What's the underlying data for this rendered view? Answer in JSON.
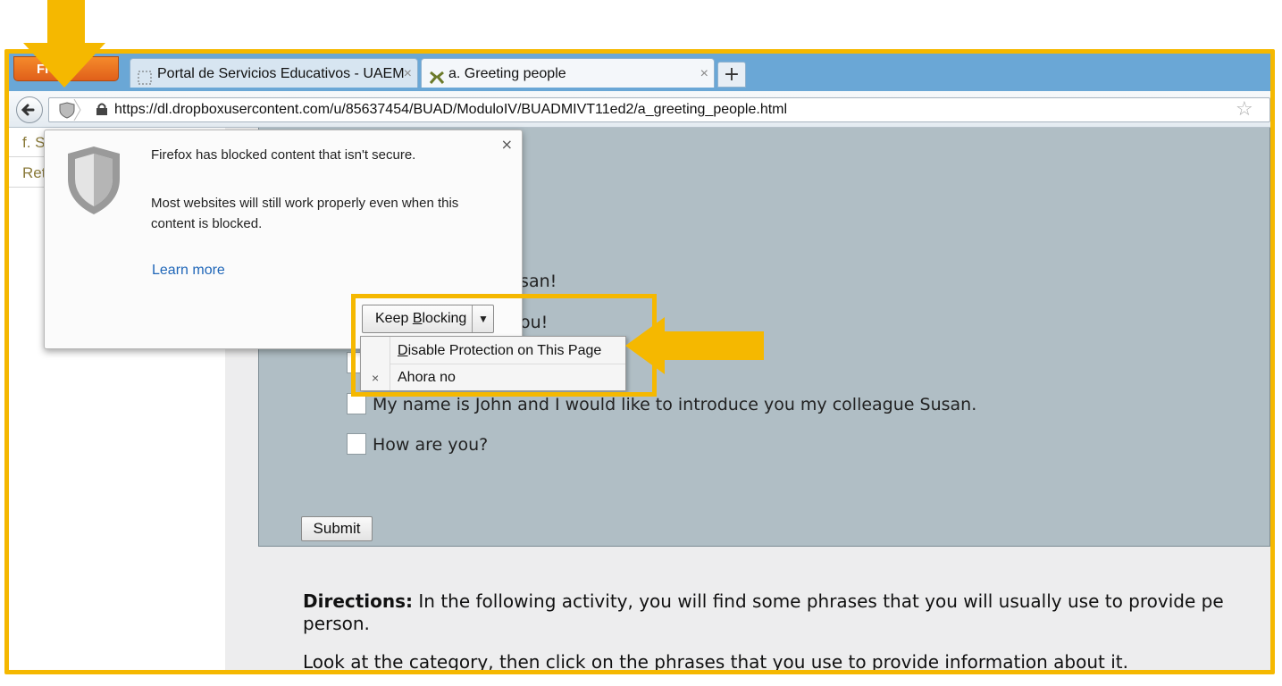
{
  "browser": {
    "menu_button": "Fi",
    "tabs": [
      {
        "title": "Portal de Servicios Educativos - UAEM",
        "close": "×"
      },
      {
        "title": "a. Greeting people",
        "close": "×"
      }
    ],
    "new_tab": "+",
    "url": "https://dl.dropboxusercontent.com/u/85637454/BUAD/ModuloIV/BUADMIVT11ed2/a_greeting_people.html"
  },
  "sidebar": {
    "items": [
      {
        "label": "f. S"
      },
      {
        "label": "Ret"
      }
    ]
  },
  "popup": {
    "close": "×",
    "line1": "Firefox has blocked content that isn't secure.",
    "line2a": "Most websites will still work properly even when this",
    "line2b": "content is blocked.",
    "learn_more": "Learn more",
    "keep_blocking_pre": "Keep ",
    "keep_blocking_acc": "B",
    "keep_blocking_post": "locking",
    "dropdown_arrow": "▼"
  },
  "menu": {
    "item1_acc": "D",
    "item1_rest": "isable Protection on This Page",
    "item2": "Ahora no",
    "item2_icon": "×"
  },
  "activity": {
    "phrases": [
      {
        "text": "usan!"
      },
      {
        "text": "ou!"
      },
      {
        "text": ""
      },
      {
        "text": "My name is John and I would like to introduce you my colleague Susan."
      },
      {
        "text": "How are you?"
      }
    ],
    "submit": "Submit",
    "directions_label": "Directions:",
    "directions_text": " In the following activity, you will find some phrases that you will usually use to provide pe",
    "directions_text2": "person.",
    "look_text": "Look at the category, then click on the phrases that you use to provide information about it."
  },
  "colors": {
    "annotation": "#f5b800",
    "panel": "#b0bec5",
    "link": "#1f66b8"
  }
}
